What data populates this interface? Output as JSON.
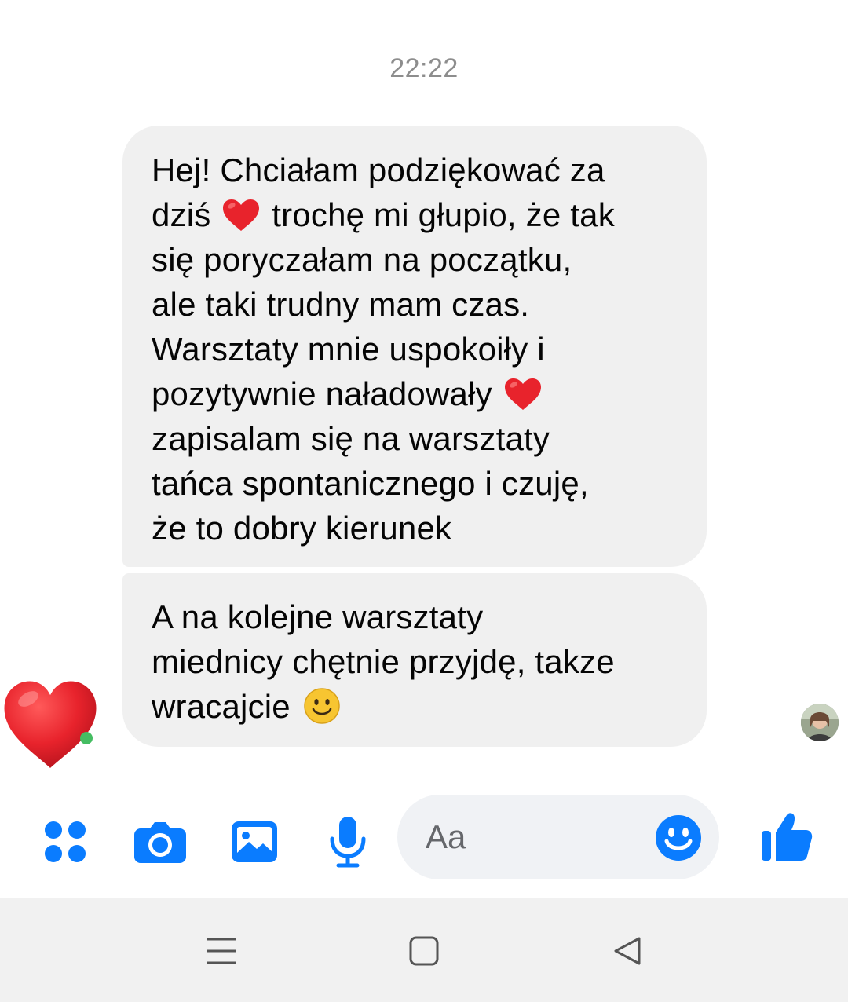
{
  "conversation": {
    "timestamp": "22:22",
    "messages": [
      {
        "lines": [
          [
            "Hej! Chciałam podziękować za"
          ],
          [
            "dziś",
            "{heart}",
            "trochę mi głupio, że tak"
          ],
          [
            "się poryczałam na początku,"
          ],
          [
            "ale taki trudny mam czas."
          ],
          [
            "Warsztaty mnie uspokoiły i"
          ],
          [
            "pozytywnie naładowały",
            "{heart}"
          ],
          [
            "zapisalam się na warsztaty"
          ],
          [
            "tańca spontanicznego i czuję,"
          ],
          [
            "że to dobry kierunek"
          ]
        ]
      },
      {
        "lines": [
          [
            "A na kolejne warsztaty"
          ],
          [
            "miednicy chętnie przyjdę, takze"
          ],
          [
            "wracajcie",
            "{smile}"
          ]
        ]
      }
    ],
    "reaction": {
      "icon": "red-heart-icon",
      "color": "#e8232c"
    },
    "seen_avatar_icon": "seen-avatar-icon"
  },
  "composer": {
    "placeholder": "Aa",
    "icons": {
      "apps": "apps-icon",
      "camera": "camera-icon",
      "gallery": "gallery-icon",
      "mic": "microphone-icon",
      "emoji": "emoji-icon",
      "like": "thumbs-up-icon"
    },
    "accent_color": "#0a7cff"
  },
  "navbar": {
    "icons": [
      "menu-icon",
      "home-icon",
      "back-icon"
    ]
  }
}
